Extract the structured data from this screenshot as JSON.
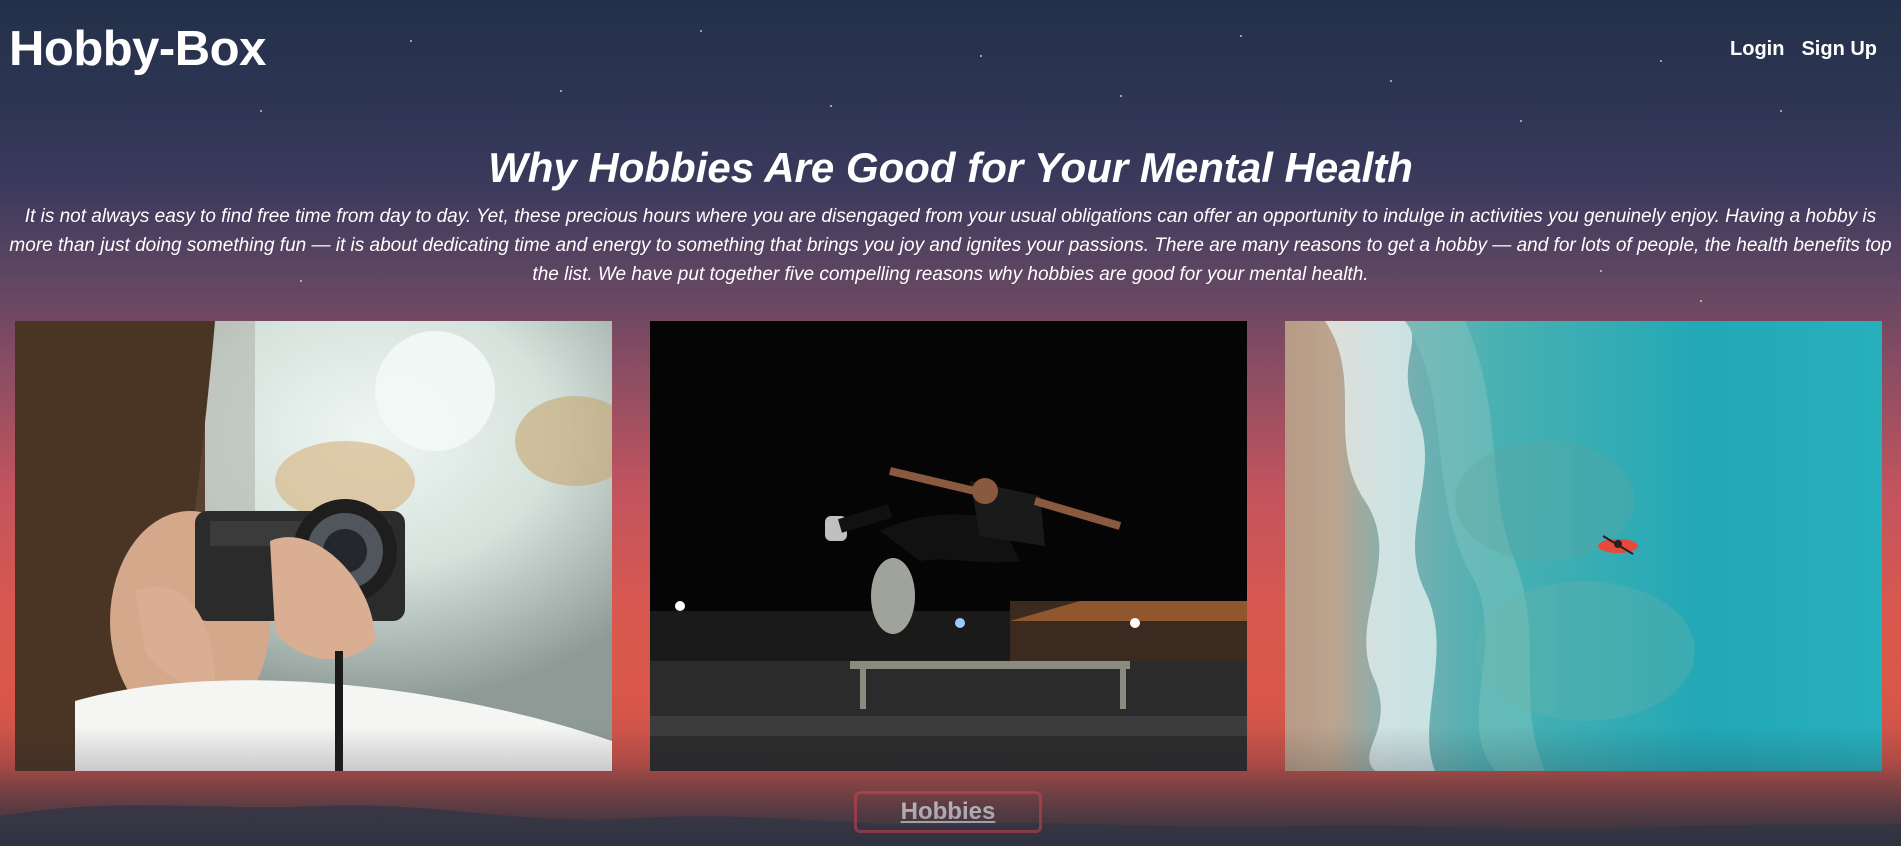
{
  "header": {
    "logo": "Hobby-Box",
    "nav": {
      "login": "Login",
      "signup": "Sign Up"
    }
  },
  "main": {
    "title": "Why Hobbies Are Good for Your Mental Health",
    "intro": "It is not always easy to find free time from day to day. Yet, these precious hours where you are disengaged from your usual obligations can offer an opportunity to indulge in activities you genuinely enjoy. Having a hobby is more than just doing something fun — it is about dedicating time and energy to something that brings you joy and ignites your passions. There are many reasons to get a hobby — and for lots of people, the health benefits top the list. We have put together five compelling reasons why hobbies are good for your mental health."
  },
  "gallery": {
    "photos": [
      {
        "subject": "photographer-with-camera"
      },
      {
        "subject": "skateboarder-jump-at-night"
      },
      {
        "subject": "kayak-aerial-ocean"
      }
    ]
  },
  "cta": {
    "label": "Hobbies"
  },
  "colors": {
    "sky_top": "#243049",
    "sky_bottom": "#d9574a",
    "button_border": "#e24a55",
    "text": "#ffffff"
  }
}
